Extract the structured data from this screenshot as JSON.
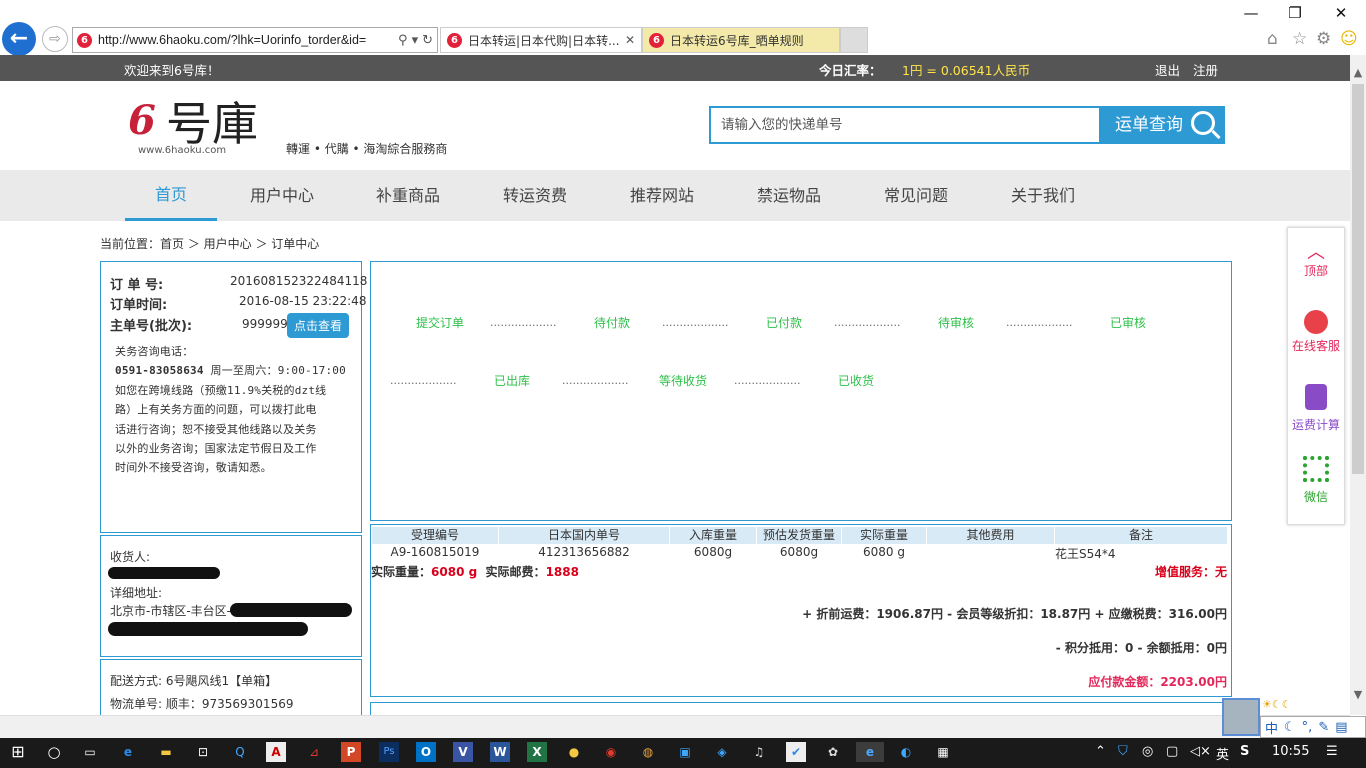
{
  "browser": {
    "url": "http://www.6haoku.com/?lhk=Uorinfo_torder&id=",
    "tabs": [
      {
        "title": "日本转运|日本代购|日本转..."
      },
      {
        "title": "日本转运6号库_晒单规则"
      }
    ],
    "favicon_text": "6"
  },
  "topbar": {
    "welcome": "欢迎来到6号库！",
    "rate_label": "今日汇率：",
    "rate_value": "1円 = 0.06541人民币",
    "logout": "退出",
    "register": "注册"
  },
  "header": {
    "logo_num": "6",
    "logo_text": "号庫",
    "logo_url": "www.6haoku.com",
    "slogan": "轉運 • 代購 • 海淘綜合服務商",
    "search_placeholder": "请输入您的快递单号",
    "search_button": "运单查询"
  },
  "nav": [
    "首页",
    "用户中心",
    "补重商品",
    "转运资费",
    "推荐网站",
    "禁运物品",
    "常见问题",
    "关于我们"
  ],
  "breadcrumb": "当前位置：首页 ＞ 用户中心 ＞ 订单中心",
  "order": {
    "no_label": "订 单 号:",
    "no_value": "201608152322484118",
    "time_label": "订单时间:",
    "time_value": "2016-08-15 23:22:48",
    "main_label": "主单号(批次):",
    "main_value": "999999",
    "view_button": "点击查看",
    "consult_title": "关务咨询电话：",
    "consult_phone": "0591-83058634",
    "consult_hours": " 周一至周六：9:00-17:00",
    "consult_lines": [
      "如您在跨境线路（预缴11.9%关税的dzt线",
      "路）上有关务方面的问题，可以拨打此电",
      "话进行咨询；恕不接受其他线路以及关务",
      "以外的业务咨询；国家法定节假日及工作",
      "时间外不接受咨询，敬请知悉。"
    ]
  },
  "receiver": {
    "label": "收货人:",
    "addr_label": "详细地址:",
    "addr_value": "北京市-市辖区-丰台区-"
  },
  "shipping": {
    "method": "配送方式: 6号飓风线1【单箱】",
    "tracking": "物流单号: 顺丰：973569301569"
  },
  "status_steps": {
    "row1": [
      "提交订单",
      "待付款",
      "已付款",
      "待审核",
      "已审核"
    ],
    "row2": [
      "已出库",
      "等待收货",
      "已收货"
    ],
    "dots": "..................."
  },
  "detail": {
    "headers": [
      "受理编号",
      "日本国内单号",
      "入库重量",
      "预估发货重量",
      "实际重量",
      "其他费用",
      "备注"
    ],
    "row": [
      "A9-160815019",
      "412313656882",
      "6080g",
      "6080g",
      "6080 g",
      "",
      "花王S54*4"
    ],
    "actual_weight_label": "实际重量：",
    "actual_weight_value": "6080 g",
    "actual_postage_label": "实际邮费：",
    "actual_postage_value": "1888",
    "value_added": "增值服务：无",
    "fee_line": "+ 折前运费：1906.87円 - 会员等级折扣：18.87円 + 应缴税费：316.00円",
    "deduct_line": "- 积分抵用：0 - 余额抵用：0円",
    "payable_label": "应付款金额：",
    "payable_value": "2203.00円"
  },
  "float_menu": [
    "顶部",
    "在线客服",
    "运费计算",
    "微信"
  ],
  "taskbar": {
    "clock": "10:55",
    "ime_lang": "英",
    "ime_cn": "中"
  },
  "colors": {
    "accent": "#2e9ad4",
    "status_green": "#2ec04a",
    "alert_red": "#d9001b",
    "pink": "#e3275a",
    "rate_yellow": "#ffe54a"
  }
}
